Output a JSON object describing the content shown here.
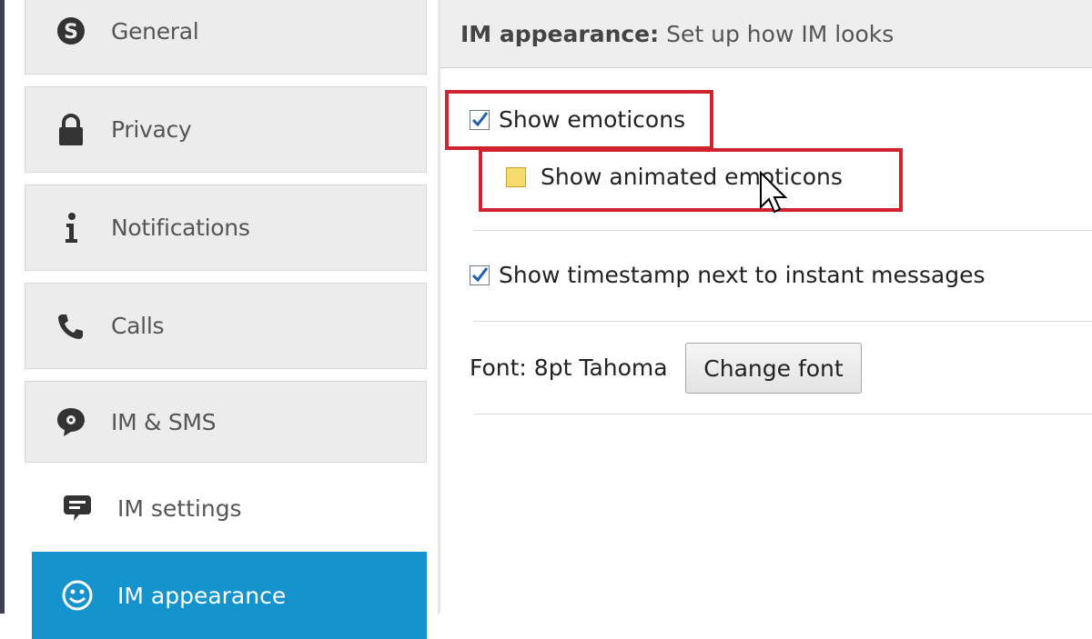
{
  "sidebar": {
    "items": [
      {
        "label": "General",
        "icon": "skype-icon"
      },
      {
        "label": "Privacy",
        "icon": "lock-icon"
      },
      {
        "label": "Notifications",
        "icon": "info-icon"
      },
      {
        "label": "Calls",
        "icon": "phone-icon"
      },
      {
        "label": "IM & SMS",
        "icon": "chat-bubble-icon"
      }
    ],
    "subitems": [
      {
        "label": "IM settings",
        "icon": "message-icon"
      },
      {
        "label": "IM appearance",
        "icon": "smiley-icon",
        "active": true
      }
    ]
  },
  "header": {
    "title": "IM appearance:",
    "description": "Set up how IM looks"
  },
  "options": {
    "show_emoticons": {
      "label": "Show emoticons",
      "checked": true
    },
    "show_animated_emoticons": {
      "label": "Show animated emoticons",
      "checked": false
    },
    "show_timestamp": {
      "label": "Show timestamp next to instant messages",
      "checked": true
    }
  },
  "font": {
    "label": "Font: 8pt Tahoma",
    "button_label": "Change font"
  },
  "colors": {
    "active": "#1493cd",
    "highlight": "#d1232f",
    "check": "#1e5fb3"
  }
}
